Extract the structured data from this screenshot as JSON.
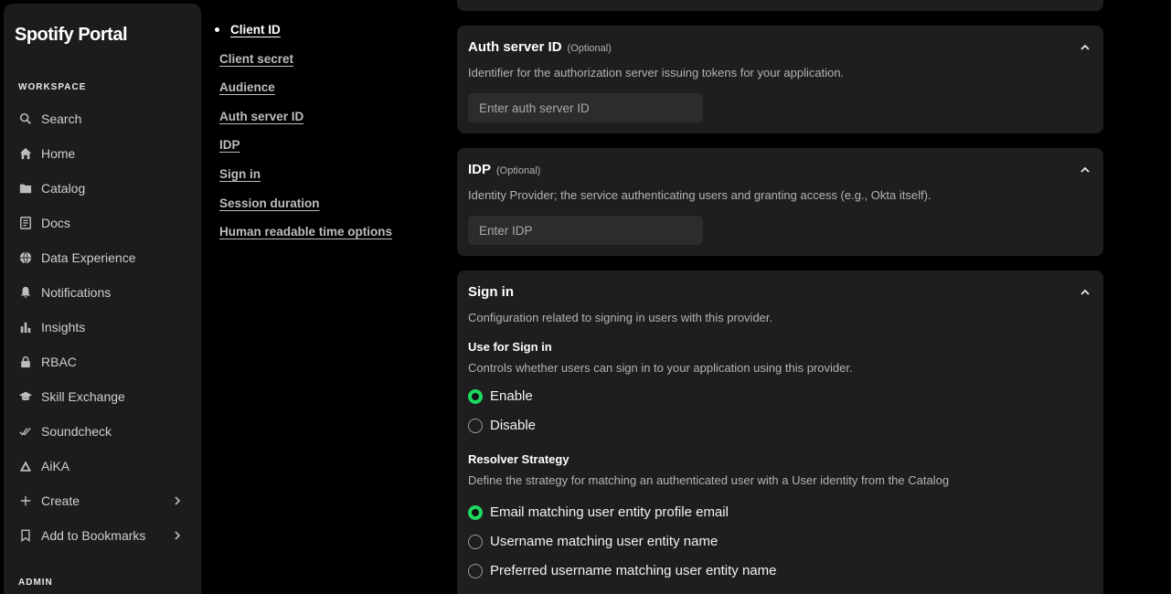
{
  "app": {
    "title": "Spotify Portal"
  },
  "sidebar": {
    "workspace_label": "WORKSPACE",
    "admin_label": "ADMIN",
    "items": [
      {
        "label": "Search",
        "icon": "search-icon"
      },
      {
        "label": "Home",
        "icon": "home-icon"
      },
      {
        "label": "Catalog",
        "icon": "folder-icon"
      },
      {
        "label": "Docs",
        "icon": "docs-icon"
      },
      {
        "label": "Data Experience",
        "icon": "globe-icon"
      },
      {
        "label": "Notifications",
        "icon": "bell-icon"
      },
      {
        "label": "Insights",
        "icon": "bar-chart-icon"
      },
      {
        "label": "RBAC",
        "icon": "lock-icon"
      },
      {
        "label": "Skill Exchange",
        "icon": "graduation-cap-icon"
      },
      {
        "label": "Soundcheck",
        "icon": "double-check-icon"
      },
      {
        "label": "AiKA",
        "icon": "triangle-icon"
      },
      {
        "label": "Create",
        "icon": "plus-icon"
      },
      {
        "label": "Add to Bookmarks",
        "icon": "bookmark-icon"
      }
    ]
  },
  "toc": {
    "items": [
      "Client ID",
      "Client secret",
      "Audience",
      "Auth server ID",
      "IDP",
      "Sign in",
      "Session duration",
      "Human readable time options"
    ]
  },
  "auth_server": {
    "title": "Auth server ID",
    "optional": "(Optional)",
    "description": "Identifier for the authorization server issuing tokens for your application.",
    "placeholder": "Enter auth server ID"
  },
  "idp": {
    "title": "IDP",
    "optional": "(Optional)",
    "description": "Identity Provider; the service authenticating users and granting access (e.g., Okta itself).",
    "placeholder": "Enter IDP"
  },
  "signin": {
    "title": "Sign in",
    "description": "Configuration related to signing in users with this provider.",
    "use_title": "Use for Sign in",
    "use_description": "Controls whether users can sign in to your application using this provider.",
    "use_options": [
      "Enable",
      "Disable"
    ],
    "use_selected": "Enable",
    "resolver_title": "Resolver Strategy",
    "resolver_description": "Define the strategy for matching an authenticated user with a User identity from the Catalog",
    "resolver_options": [
      "Email matching user entity profile email",
      "Username matching user entity name",
      "Preferred username matching user entity name"
    ],
    "resolver_selected": "Email matching user entity profile email"
  },
  "colors": {
    "accent": "#1ed760",
    "card": "#1e1e1e",
    "sidebar": "#1c1c1c"
  }
}
